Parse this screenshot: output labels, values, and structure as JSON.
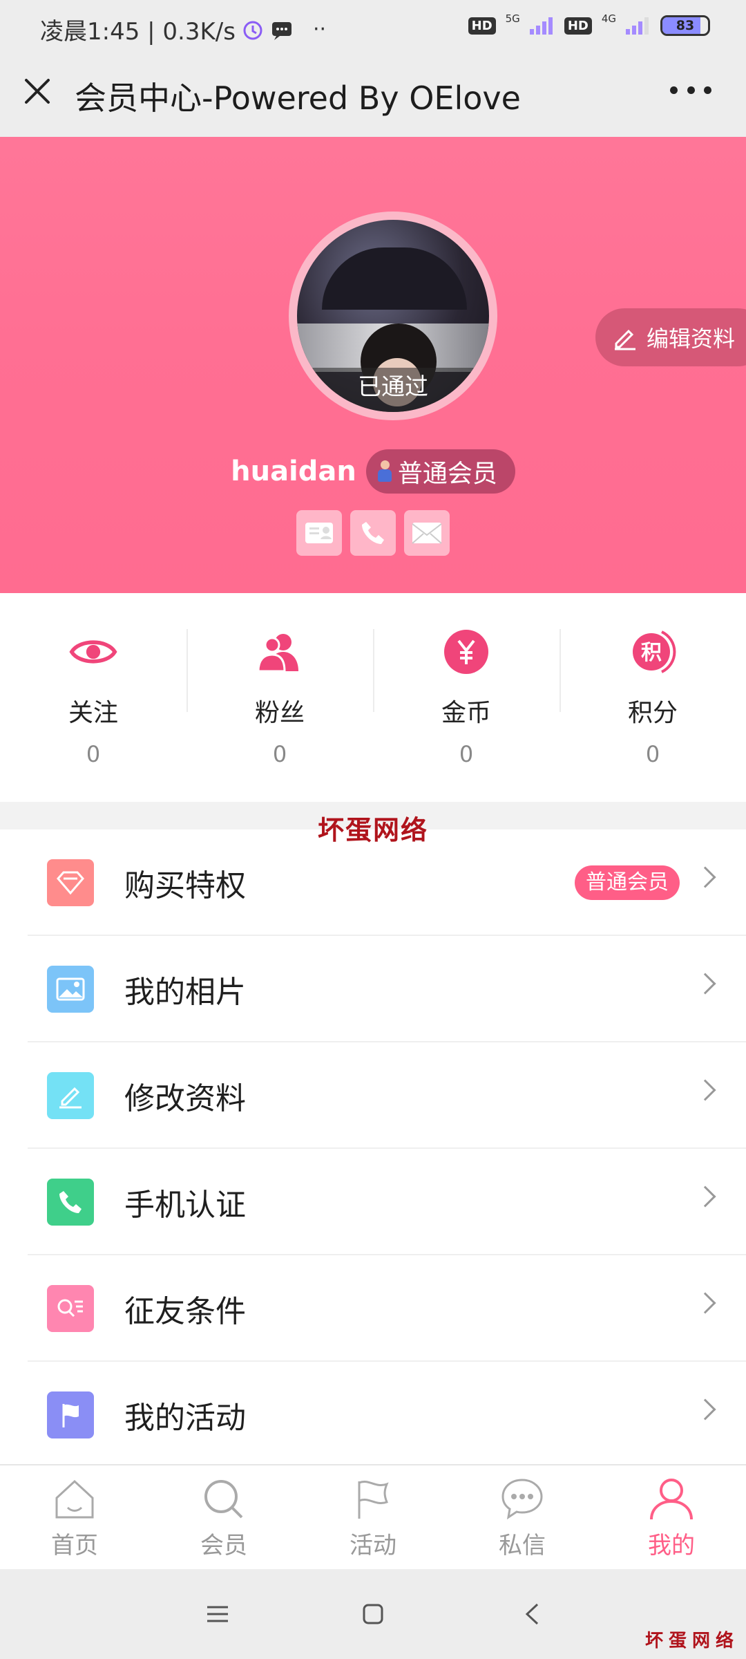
{
  "status_bar": {
    "time_speed": "凌晨1:45 | 0.3K/s",
    "hd1": "HD",
    "net1": "5G",
    "hd2": "HD",
    "net2": "4G",
    "battery": "83"
  },
  "header": {
    "title": "会员中心-Powered By OElove",
    "close_icon": "close-icon",
    "more_icon": "more-dots-icon"
  },
  "profile": {
    "avatar_status": "已通过",
    "edit_label": "编辑资料",
    "username": "huaidan",
    "level": "普通会员",
    "verify_icons": [
      "id-card-icon",
      "phone-icon",
      "mail-icon"
    ]
  },
  "stats": [
    {
      "label": "关注",
      "value": "0",
      "icon": "eye-icon"
    },
    {
      "label": "粉丝",
      "value": "0",
      "icon": "fans-icon"
    },
    {
      "label": "金币",
      "value": "0",
      "icon": "coin-icon"
    },
    {
      "label": "积分",
      "value": "0",
      "icon": "points-icon"
    }
  ],
  "watermark": "坏蛋网络",
  "menu": [
    {
      "label": "购买特权",
      "badge": "普通会员",
      "icon": "diamond-icon",
      "color": "#ff8c8c"
    },
    {
      "label": "我的相片",
      "badge": "",
      "icon": "photo-icon",
      "color": "#7cc4f8"
    },
    {
      "label": "修改资料",
      "badge": "",
      "icon": "edit-icon",
      "color": "#74e1f5"
    },
    {
      "label": "手机认证",
      "badge": "",
      "icon": "phone-icon",
      "color": "#3fcf8a"
    },
    {
      "label": "征友条件",
      "badge": "",
      "icon": "search-list-icon",
      "color": "#ff86b0"
    },
    {
      "label": "我的活动",
      "badge": "",
      "icon": "flag-icon",
      "color": "#8a8ef5"
    }
  ],
  "bottom_nav": [
    {
      "label": "首页",
      "icon": "home-icon",
      "active": false
    },
    {
      "label": "会员",
      "icon": "search-icon",
      "active": false
    },
    {
      "label": "活动",
      "icon": "flag-icon",
      "active": false
    },
    {
      "label": "私信",
      "icon": "chat-icon",
      "active": false
    },
    {
      "label": "我的",
      "icon": "user-icon",
      "active": true
    }
  ],
  "corner_mark": "坏蛋网络",
  "colors": {
    "accent": "#ff5e87",
    "hero": "#ff7a9a",
    "watermark": "#b0141c"
  }
}
